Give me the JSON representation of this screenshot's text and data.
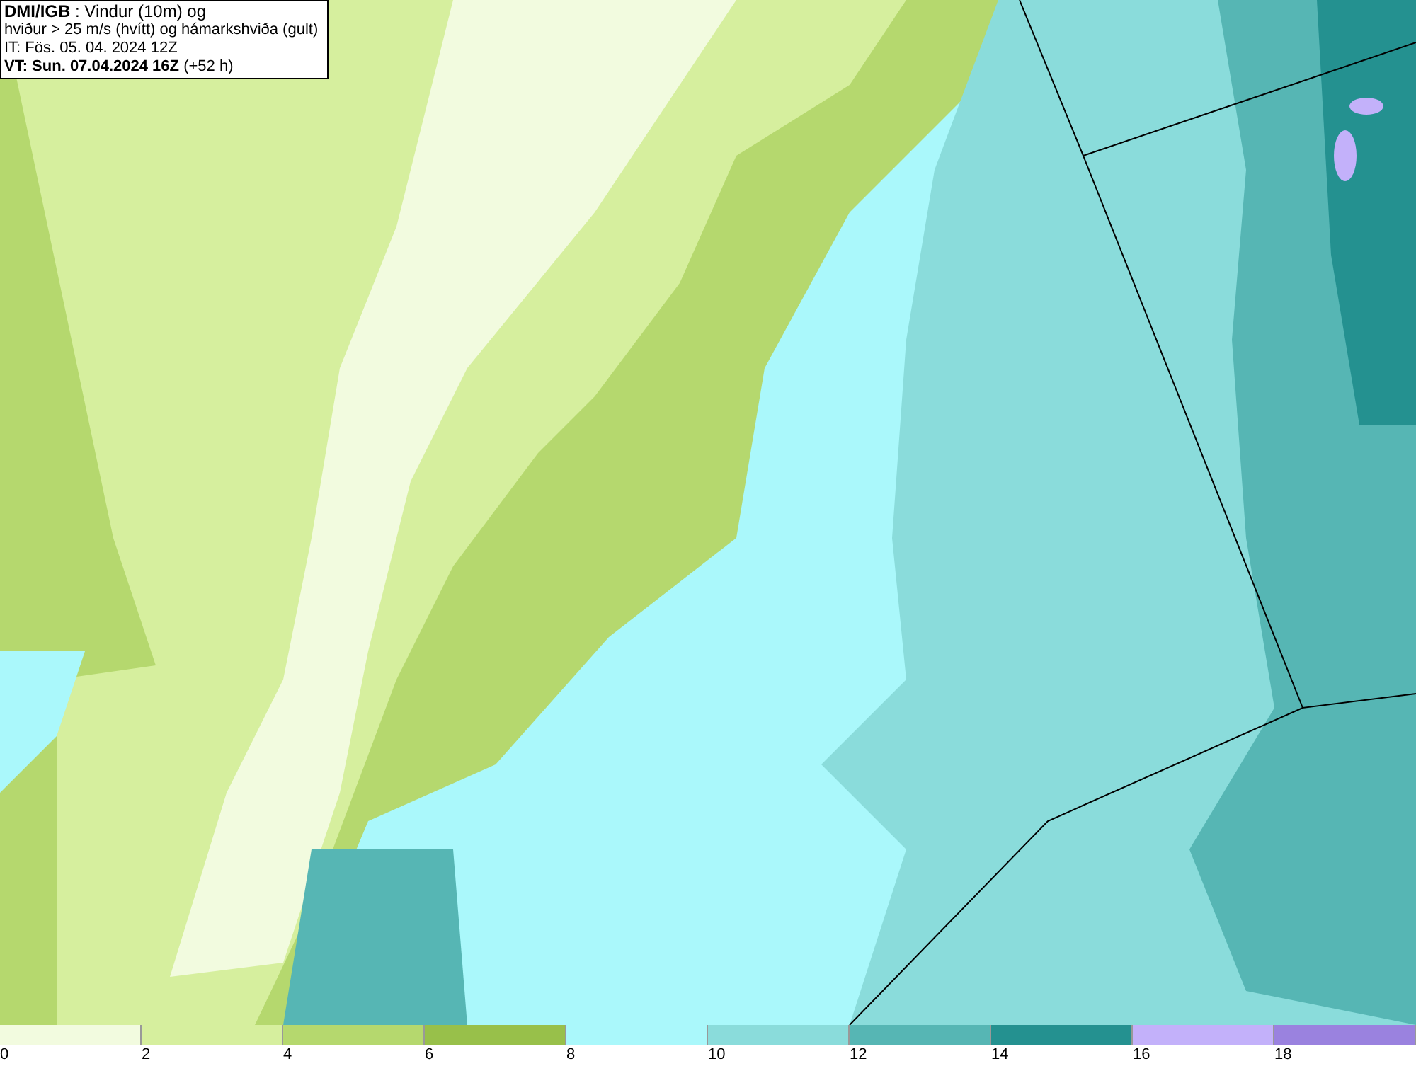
{
  "title_box": {
    "lines": [
      "**DMI/IGB** : Vindur (10m) og",
      "hviður > 25 m/s (hvítt) og hámarkshviða (gult)",
      "IT: Fös. 05. 04. 2024 12Z",
      "**VT: Sun. 07.04.2024 16Z** (+52 h)"
    ]
  },
  "legend": {
    "bins": [
      {
        "label": "0",
        "color": "#f2fbdf"
      },
      {
        "label": "2",
        "color": "#d6ef9e"
      },
      {
        "label": "4",
        "color": "#b5d86e"
      },
      {
        "label": "6",
        "color": "#98c04a"
      },
      {
        "label": "8",
        "color": "#aaf8fb"
      },
      {
        "label": "10",
        "color": "#8adcdb"
      },
      {
        "label": "12",
        "color": "#56b6b4"
      },
      {
        "label": "14",
        "color": "#249190"
      },
      {
        "label": "16",
        "color": "#c3b1fa"
      },
      {
        "label": "18",
        "color": "#9a82df"
      }
    ]
  }
}
